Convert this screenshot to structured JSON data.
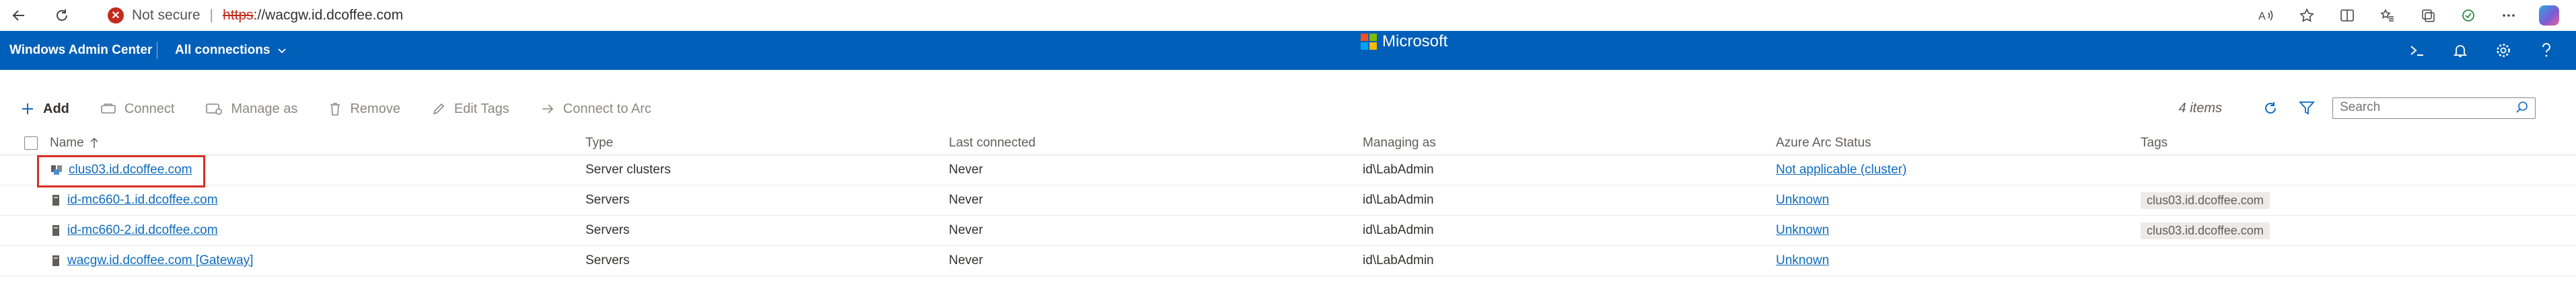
{
  "browser": {
    "security_label": "Not secure",
    "url_scheme": "https",
    "url_rest": "://wacgw.id.dcoffee.com",
    "icons": [
      "back-arrow-icon",
      "refresh-icon",
      "not-secure-icon",
      "read-aloud-icon",
      "favorite-star-icon",
      "split-screen-icon",
      "favorites-icon",
      "collections-icon",
      "extensions-icon",
      "more-options-icon",
      "copilot-icon"
    ]
  },
  "header": {
    "app_title": "Windows Admin Center",
    "connections_label": "All connections",
    "brand": "Microsoft",
    "icons": [
      "terminal-icon",
      "notifications-bell-icon",
      "settings-gear-icon",
      "help-icon"
    ]
  },
  "toolbar": {
    "add": "Add",
    "connect": "Connect",
    "manage_as": "Manage as",
    "remove": "Remove",
    "edit_tags": "Edit Tags",
    "connect_arc": "Connect to Arc",
    "items_count": "4 items",
    "search_placeholder": "Search"
  },
  "table": {
    "columns": {
      "name": "Name",
      "type": "Type",
      "last_connected": "Last connected",
      "managing_as": "Managing as",
      "arc_status": "Azure Arc Status",
      "tags": "Tags"
    },
    "rows": [
      {
        "name": "clus03.id.dcoffee.com",
        "icon": "server-cluster-icon",
        "type": "Server clusters",
        "last": "Never",
        "managing": "id\\LabAdmin",
        "arc": "Not applicable (cluster)",
        "tag": ""
      },
      {
        "name": "id-mc660-1.id.dcoffee.com",
        "icon": "server-icon",
        "type": "Servers",
        "last": "Never",
        "managing": "id\\LabAdmin",
        "arc": "Unknown",
        "tag": "clus03.id.dcoffee.com"
      },
      {
        "name": "id-mc660-2.id.dcoffee.com",
        "icon": "server-icon",
        "type": "Servers",
        "last": "Never",
        "managing": "id\\LabAdmin",
        "arc": "Unknown",
        "tag": "clus03.id.dcoffee.com"
      },
      {
        "name": "wacgw.id.dcoffee.com [Gateway]",
        "icon": "server-icon",
        "type": "Servers",
        "last": "Never",
        "managing": "id\\LabAdmin",
        "arc": "Unknown",
        "tag": ""
      }
    ]
  },
  "colors": {
    "header_blue": "#005fb8",
    "link_blue": "#0f6cbd",
    "highlight_red": "#d93025",
    "insecure_red": "#c42b1c"
  }
}
